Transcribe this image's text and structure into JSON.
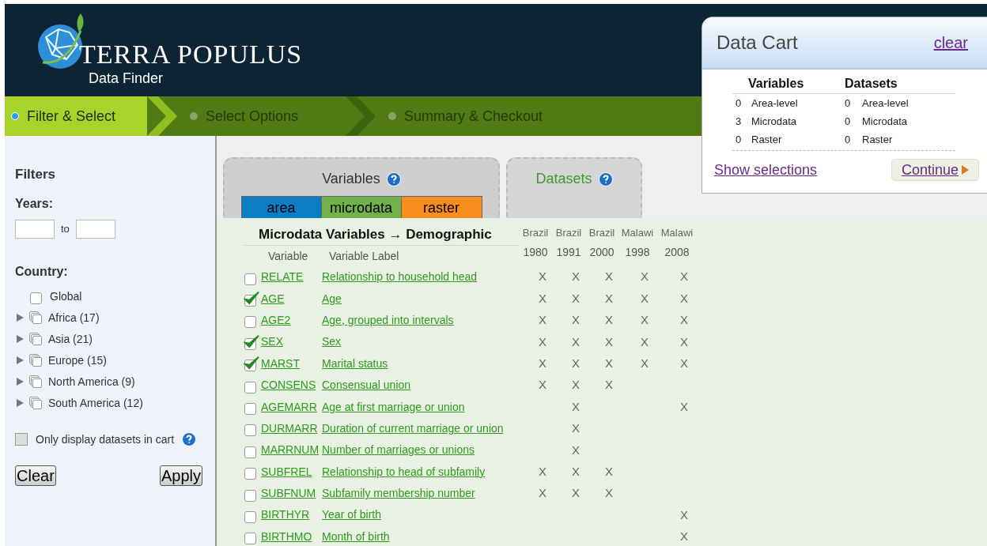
{
  "header": {
    "title": "TERRA POPULUS",
    "subtitle": "Data Finder"
  },
  "steps": [
    {
      "label": "Filter & Select",
      "selected": true
    },
    {
      "label": "Select Options",
      "selected": false
    },
    {
      "label": "Summary & Checkout",
      "selected": false
    }
  ],
  "filters": {
    "title": "Filters",
    "years_label": "Years:",
    "to": "to",
    "country_label": "Country:",
    "countries": [
      {
        "label": "Global",
        "expandable": false,
        "checked": false
      },
      {
        "label": "Africa (17)",
        "expandable": true,
        "checked": false
      },
      {
        "label": "Asia (21)",
        "expandable": true,
        "checked": false
      },
      {
        "label": "Europe (15)",
        "expandable": true,
        "checked": false
      },
      {
        "label": "North America (9)",
        "expandable": true,
        "checked": false
      },
      {
        "label": "South America (12)",
        "expandable": true,
        "checked": false
      }
    ],
    "only_in_cart": {
      "label": "Only display datasets in cart",
      "checked": false
    },
    "buttons": [
      "Clear",
      "Apply"
    ]
  },
  "tabs": [
    {
      "label": "Variables",
      "selected": true
    },
    {
      "label": "Datasets",
      "selected": false
    }
  ],
  "variable_types": [
    {
      "label": "area",
      "color": "#0b7dc4"
    },
    {
      "label": "microdata",
      "color": "#72b04c"
    },
    {
      "label": "raster",
      "color": "#fb8c1e"
    }
  ],
  "table": {
    "title": "Microdata Variables → Demographic",
    "columns": [
      "Variable",
      "Variable Label"
    ],
    "samples": [
      {
        "country": "Brazil",
        "year": "1980"
      },
      {
        "country": "Brazil",
        "year": "1991"
      },
      {
        "country": "Brazil",
        "year": "2000"
      },
      {
        "country": "Malawi",
        "year": "1998"
      },
      {
        "country": "Malawi",
        "year": "2008"
      }
    ],
    "rows": [
      {
        "variable": "RELATE",
        "label": "Relationship to household head",
        "checked": false,
        "cells": [
          "X",
          "X",
          "X",
          "X",
          "X"
        ]
      },
      {
        "variable": "AGE",
        "label": "Age",
        "checked": true,
        "cells": [
          "X",
          "X",
          "X",
          "X",
          "X"
        ]
      },
      {
        "variable": "AGE2",
        "label": "Age, grouped into intervals",
        "checked": false,
        "cells": [
          "X",
          "X",
          "X",
          "X",
          "X"
        ]
      },
      {
        "variable": "SEX",
        "label": "Sex",
        "checked": true,
        "cells": [
          "X",
          "X",
          "X",
          "X",
          "X"
        ]
      },
      {
        "variable": "MARST",
        "label": "Marital status",
        "checked": true,
        "cells": [
          "X",
          "X",
          "X",
          "X",
          "X"
        ]
      },
      {
        "variable": "CONSENS",
        "label": "Consensual union",
        "checked": false,
        "cells": [
          "X",
          "X",
          "X",
          null,
          null
        ]
      },
      {
        "variable": "AGEMARR",
        "label": "Age at first marriage or union",
        "checked": false,
        "cells": [
          null,
          "X",
          null,
          null,
          "X"
        ]
      },
      {
        "variable": "DURMARR",
        "label": "Duration of current marriage or union",
        "checked": false,
        "cells": [
          null,
          "X",
          null,
          null,
          null
        ]
      },
      {
        "variable": "MARRNUM",
        "label": "Number of marriages or unions",
        "checked": false,
        "cells": [
          null,
          "X",
          null,
          null,
          null
        ]
      },
      {
        "variable": "SUBFREL",
        "label": "Relationship to head of subfamily",
        "checked": false,
        "cells": [
          "X",
          "X",
          "X",
          null,
          null
        ]
      },
      {
        "variable": "SUBFNUM",
        "label": "Subfamily membership number",
        "checked": false,
        "cells": [
          "X",
          "X",
          "X",
          null,
          null
        ]
      },
      {
        "variable": "BIRTHYR",
        "label": "Year of birth",
        "checked": false,
        "cells": [
          null,
          null,
          null,
          null,
          "X"
        ]
      },
      {
        "variable": "BIRTHMO",
        "label": "Month of birth",
        "checked": false,
        "cells": [
          null,
          null,
          null,
          null,
          "X"
        ]
      }
    ]
  },
  "cart": {
    "title": "Data Cart",
    "clear": "clear",
    "headers": [
      "Variables",
      "Datasets"
    ],
    "rows": [
      {
        "var_count": "0",
        "var_label": "Area-level",
        "ds_count": "0",
        "ds_label": "Area-level"
      },
      {
        "var_count": "3",
        "var_label": "Microdata",
        "ds_count": "0",
        "ds_label": "Microdata"
      },
      {
        "var_count": "0",
        "var_label": "Raster",
        "ds_count": "0",
        "ds_label": "Raster"
      }
    ],
    "show": "Show selections",
    "continue": "Continue"
  }
}
